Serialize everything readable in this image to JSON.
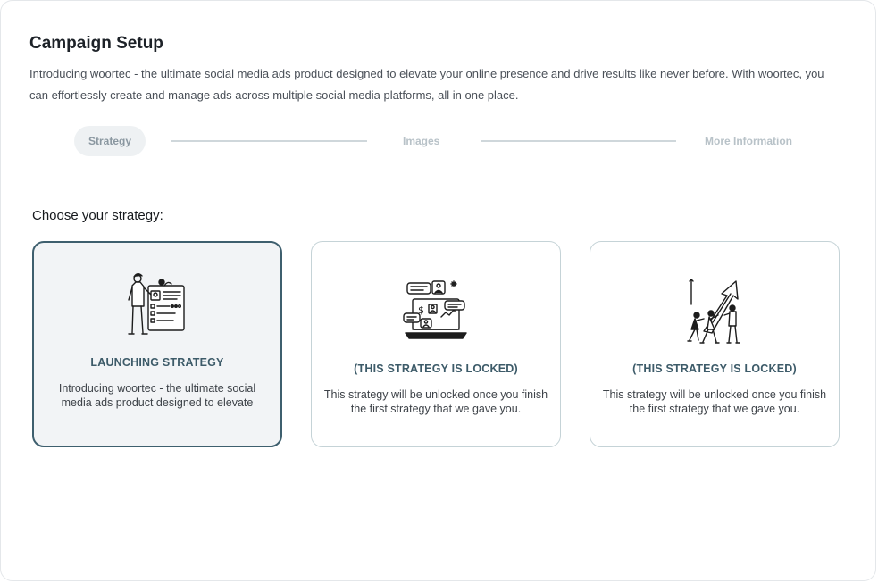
{
  "header": {
    "title": "Campaign Setup",
    "intro": "Introducing woortec - the ultimate social media ads product designed to elevate your online presence and drive results like never before. With woortec, you can effortlessly create and manage ads across multiple social media platforms, all in one place."
  },
  "stepper": {
    "steps": [
      {
        "label": "Strategy",
        "active": true
      },
      {
        "label": "Images",
        "active": false
      },
      {
        "label": "More Information",
        "active": false
      }
    ]
  },
  "strategy": {
    "section_label": "Choose your strategy:",
    "cards": [
      {
        "title": "LAUNCHING STRATEGY",
        "description": "Introducing woortec - the ultimate social media ads product designed to elevate",
        "state": "selected",
        "illustration": "presenter-with-board-illustration"
      },
      {
        "title": "(THIS STRATEGY IS LOCKED)",
        "description": "This strategy will be unlocked once you finish the first strategy that we gave you.",
        "state": "locked",
        "illustration": "laptop-social-media-illustration"
      },
      {
        "title": "(THIS STRATEGY IS LOCKED)",
        "description": "This strategy will be unlocked once you finish the first strategy that we gave you.",
        "state": "locked",
        "illustration": "team-pushing-arrow-illustration"
      }
    ]
  },
  "colors": {
    "accent": "#3e5f6e",
    "card_border": "#c5d3d7",
    "step_inactive": "#b8c2c8",
    "step_active_bg": "#eef1f3"
  }
}
